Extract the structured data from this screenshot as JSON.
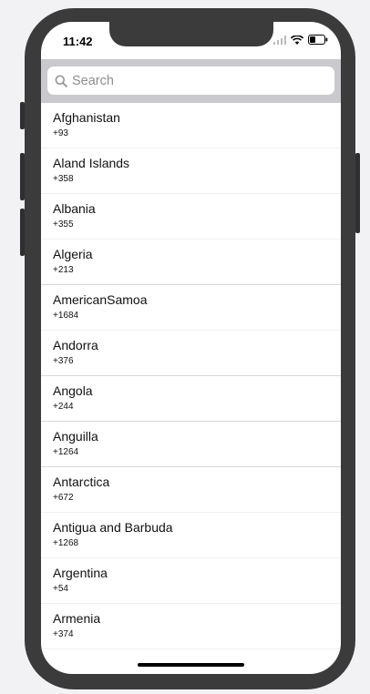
{
  "status_bar": {
    "time": "11:42",
    "icons": [
      "signal-icon",
      "wifi-icon",
      "battery-icon"
    ]
  },
  "search": {
    "placeholder": "Search",
    "value": ""
  },
  "countries": [
    {
      "name": "Afghanistan",
      "code": "+93"
    },
    {
      "name": "Aland Islands",
      "code": "+358"
    },
    {
      "name": "Albania",
      "code": "+355"
    },
    {
      "name": "Algeria",
      "code": "+213"
    },
    {
      "name": "AmericanSamoa",
      "code": "+1684"
    },
    {
      "name": "Andorra",
      "code": "+376"
    },
    {
      "name": "Angola",
      "code": "+244"
    },
    {
      "name": "Anguilla",
      "code": "+1264"
    },
    {
      "name": "Antarctica",
      "code": "+672"
    },
    {
      "name": "Antigua and Barbuda",
      "code": "+1268"
    },
    {
      "name": "Argentina",
      "code": "+54"
    },
    {
      "name": "Armenia",
      "code": "+374"
    }
  ]
}
